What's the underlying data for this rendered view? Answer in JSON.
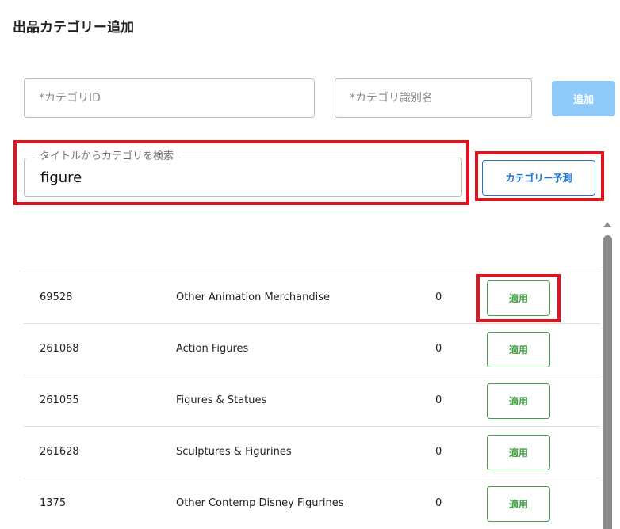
{
  "page": {
    "title": "出品カテゴリー追加"
  },
  "form": {
    "category_id_placeholder": "*カテゴリID",
    "category_name_placeholder": "*カテゴリ識別名",
    "add_button": "追加",
    "search_label": "タイトルからカテゴリを検索",
    "search_value": "figure",
    "predict_button": "カテゴリー予測"
  },
  "results": [
    {
      "id": "69528",
      "name": "Other Animation Merchandise",
      "count": "0",
      "action": "適用"
    },
    {
      "id": "261068",
      "name": "Action Figures",
      "count": "0",
      "action": "適用"
    },
    {
      "id": "261055",
      "name": "Figures & Statues",
      "count": "0",
      "action": "適用"
    },
    {
      "id": "261628",
      "name": "Sculptures & Figurines",
      "count": "0",
      "action": "適用"
    },
    {
      "id": "1375",
      "name": "Other Contemp Disney Figurines",
      "count": "0",
      "action": "適用"
    }
  ],
  "colors": {
    "highlight": "#e0141e",
    "primary": "#1976d2",
    "primary_disabled": "#90caf9",
    "success": "#43a047"
  }
}
